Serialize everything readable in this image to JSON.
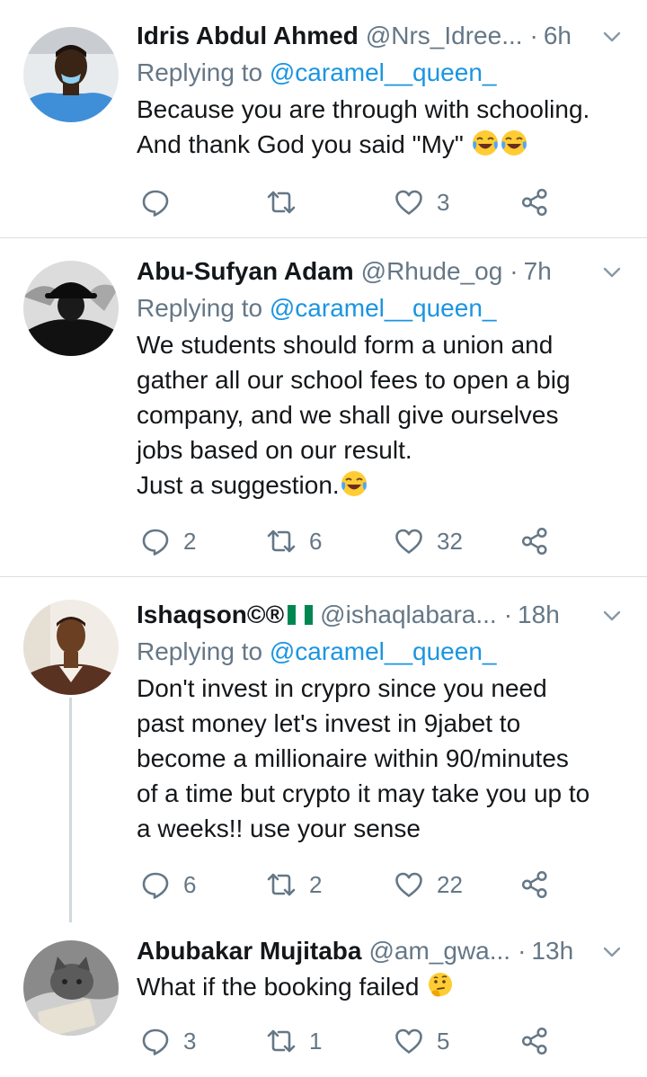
{
  "tweets": [
    {
      "name": "Idris Abdul Ahmed",
      "handle": "@Nrs_Idree...",
      "dot": "·",
      "time": "6h",
      "reply_prefix": "Replying to ",
      "reply_to": "@caramel__queen_",
      "text": "Because you are through with schooling.\nAnd thank God you said \"My\" ",
      "emoji": [
        "face-with-tears-of-joy",
        "face-with-tears-of-joy"
      ],
      "reply_count": "",
      "retweet_count": "",
      "like_count": "3"
    },
    {
      "name": "Abu-Sufyan Adam",
      "handle": "@Rhude_og",
      "dot": "·",
      "time": "7h",
      "reply_prefix": "Replying to ",
      "reply_to": "@caramel__queen_",
      "text": "We students should form a union and\ngather all our school fees to open a big\ncompany, and we shall give ourselves\njobs based on our result.\nJust a suggestion.",
      "emoji": [
        "face-with-tears-of-joy"
      ],
      "reply_count": "2",
      "retweet_count": "6",
      "like_count": "32"
    },
    {
      "name": "Ishaqson©®",
      "handle": "@ishaqlabara...",
      "dot": "·",
      "time": "18h",
      "reply_prefix": "Replying to ",
      "reply_to": "@caramel__queen_",
      "text": "Don't invest in crypro since you need\npast money let's invest in 9jabet to\nbecome a millionaire within 90/minutes\nof a time but crypto it may take you up to\na weeks!! use your sense",
      "emoji": [],
      "name_flag": "nigeria-flag",
      "reply_count": "6",
      "retweet_count": "2",
      "like_count": "22"
    },
    {
      "name": "Abubakar Mujitaba",
      "handle": "@am_gwa...",
      "dot": "·",
      "time": "13h",
      "text": "What if the booking failed ",
      "emoji": [
        "thinking-face"
      ],
      "reply_count": "3",
      "retweet_count": "1",
      "like_count": "5"
    }
  ],
  "colors": {
    "link": "#1b95e0",
    "secondary": "#657786",
    "divider": "#d9dee3",
    "nigeria_green": "#008751"
  },
  "icons": [
    "reply-icon",
    "retweet-icon",
    "like-icon",
    "share-icon",
    "chevron-down-icon"
  ]
}
